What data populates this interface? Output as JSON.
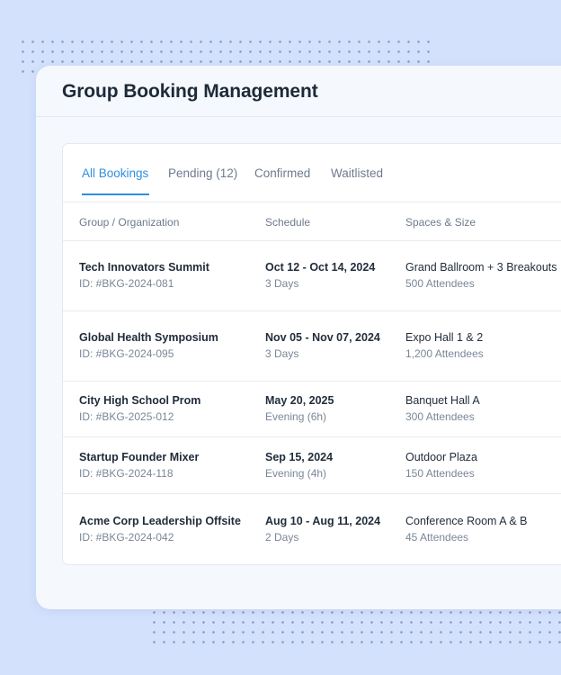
{
  "header": {
    "title": "Group Booking Management"
  },
  "tabs": [
    {
      "label": "All Bookings",
      "active": true
    },
    {
      "label": "Pending (12)",
      "active": false
    },
    {
      "label": "Confirmed",
      "active": false
    },
    {
      "label": "Waitlisted",
      "active": false
    }
  ],
  "table": {
    "columns": [
      "Group / Organization",
      "Schedule",
      "Spaces & Size"
    ],
    "rows": [
      {
        "group": "Tech Innovators Summit",
        "id": "ID: #BKG-2024-081",
        "schedule": "Oct 12 - Oct 14, 2024",
        "duration": "3 Days",
        "spaces": "Grand Ballroom + 3 Breakouts",
        "size": "500 Attendees"
      },
      {
        "group": "Global Health Symposium",
        "id": "ID: #BKG-2024-095",
        "schedule": "Nov 05 - Nov 07, 2024",
        "duration": "3 Days",
        "spaces": "Expo Hall 1 & 2",
        "size": "1,200 Attendees"
      },
      {
        "group": "City High School Prom",
        "id": "ID: #BKG-2025-012",
        "schedule": "May 20, 2025",
        "duration": "Evening (6h)",
        "spaces": "Banquet Hall A",
        "size": "300 Attendees"
      },
      {
        "group": "Startup Founder Mixer",
        "id": "ID: #BKG-2024-118",
        "schedule": "Sep 15, 2024",
        "duration": "Evening (4h)",
        "spaces": "Outdoor Plaza",
        "size": "150 Attendees"
      },
      {
        "group": "Acme Corp Leadership Offsite",
        "id": "ID: #BKG-2024-042",
        "schedule": "Aug 10 - Aug 11, 2024",
        "duration": "2 Days",
        "spaces": "Conference Room A & B",
        "size": "45 Attendees"
      }
    ]
  },
  "colors": {
    "accent": "#2f8fde",
    "background": "#d3e1fd",
    "window": "#f5f8fd",
    "panel": "#ffffff"
  }
}
